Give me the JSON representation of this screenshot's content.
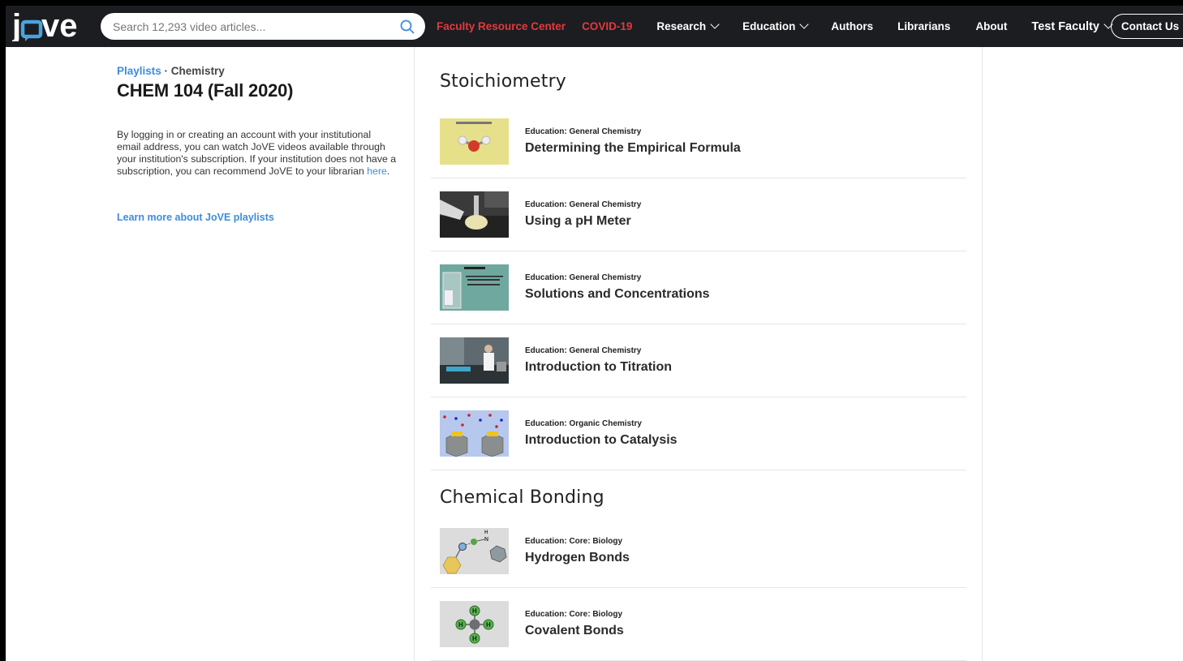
{
  "brand": {
    "logo_text": "jove"
  },
  "search": {
    "placeholder": "Search 12,293 video articles..."
  },
  "nav": {
    "faculty": "Faculty Resource Center",
    "covid": "COVID-19",
    "research": "Research",
    "education": "Education",
    "authors": "Authors",
    "librarians": "Librarians",
    "about": "About",
    "user": "Test Faculty",
    "contact": "Contact Us"
  },
  "sidebar": {
    "crumb_link": "Playlists",
    "crumb_sep": " · ",
    "crumb_current": "Chemistry",
    "title": "CHEM 104 (Fall 2020)",
    "intro_text": "By logging in or creating an account with your institutional email address, you can watch JoVE videos available through your institution's subscription. If your institution does not have a subscription, you can recommend JoVE to your librarian ",
    "intro_link": "here",
    "intro_end": ".",
    "learn_more": "Learn more about JoVE playlists"
  },
  "sections": [
    {
      "title": "Stoichiometry",
      "items": [
        {
          "category": "Education: General Chemistry",
          "title": "Determining the Empirical Formula"
        },
        {
          "category": "Education: General Chemistry",
          "title": "Using a pH Meter"
        },
        {
          "category": "Education: General Chemistry",
          "title": "Solutions and Concentrations"
        },
        {
          "category": "Education: General Chemistry",
          "title": "Introduction to Titration"
        },
        {
          "category": "Education: Organic Chemistry",
          "title": "Introduction to Catalysis"
        }
      ]
    },
    {
      "title": "Chemical Bonding",
      "items": [
        {
          "category": "Education: Core: Biology",
          "title": "Hydrogen Bonds"
        },
        {
          "category": "Education: Core: Biology",
          "title": "Covalent Bonds"
        }
      ]
    }
  ],
  "colors": {
    "nav_bg": "#1b1d21",
    "accent_red": "#e4393c",
    "link_blue": "#3c8dde",
    "logo_blue": "#4aa3df"
  }
}
